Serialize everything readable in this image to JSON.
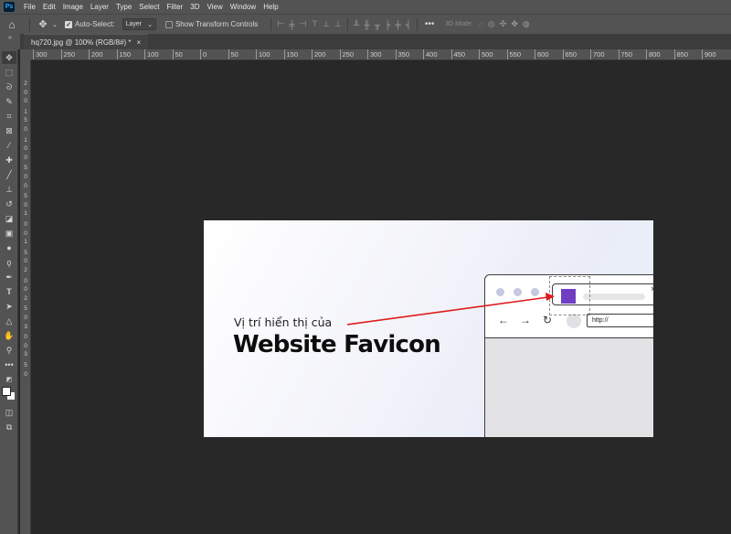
{
  "app": {
    "menu": [
      "File",
      "Edit",
      "Image",
      "Layer",
      "Type",
      "Select",
      "Filter",
      "3D",
      "View",
      "Window",
      "Help"
    ]
  },
  "options": {
    "auto_select_label": "Auto-Select:",
    "auto_select_value": "Layer",
    "transform_label": "Show Transform Controls",
    "mode_label": "3D Mode:"
  },
  "document": {
    "tab_title": "hq720.jpg @ 100% (RGB/8#) *",
    "close": "×"
  },
  "ruler": {
    "h_labels": [
      "300",
      "250",
      "200",
      "150",
      "100",
      "50",
      "0",
      "50",
      "100",
      "150",
      "200",
      "250",
      "300",
      "350",
      "400",
      "450",
      "500",
      "550",
      "600",
      "650",
      "700",
      "750",
      "800",
      "850",
      "900"
    ],
    "v_labels": [
      "2",
      "0",
      "0",
      "1",
      "5",
      "0",
      "1",
      "0",
      "0",
      "5",
      "0",
      "0",
      "5",
      "0",
      "1",
      "0",
      "0",
      "1",
      "5",
      "0",
      "2",
      "0",
      "0",
      "2",
      "5",
      "0",
      "3",
      "0",
      "0",
      "3",
      "5",
      "0"
    ]
  },
  "image_content": {
    "caption": "Vị trí hiển thị của",
    "title": "Website Favicon",
    "url": "http://",
    "arrow_color": "#e01b1b",
    "favicon_color": "#6f3ec2"
  }
}
